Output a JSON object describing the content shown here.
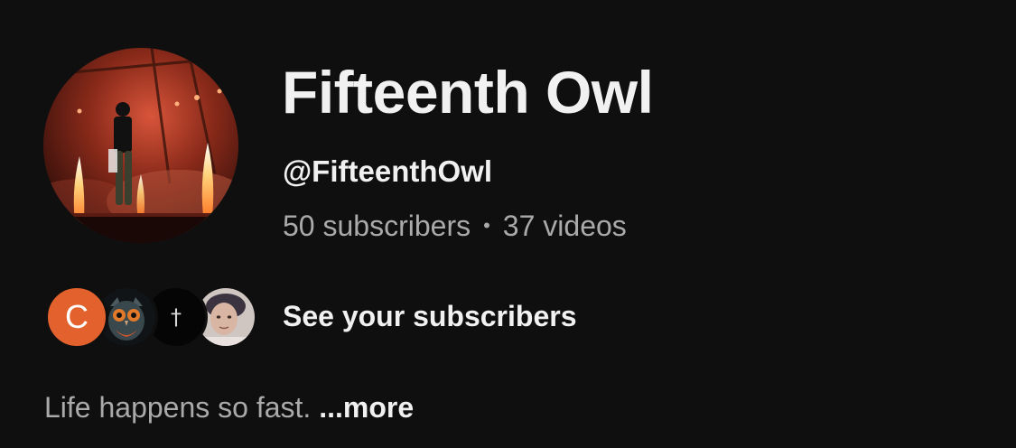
{
  "channel": {
    "name": "Fifteenth Owl",
    "handle": "@FifteenthOwl",
    "subscribers": "50 subscribers",
    "separator": "•",
    "videos": "37 videos",
    "avatar_icon": "concert-stage-photo"
  },
  "subscribers_row": {
    "avatars": [
      {
        "type": "letter",
        "letter": "C",
        "color": "#e2612c"
      },
      {
        "type": "image",
        "icon": "owl-artwork-icon"
      },
      {
        "type": "glyph",
        "glyph": "†"
      },
      {
        "type": "image",
        "icon": "person-photo-icon"
      }
    ],
    "link_label": "See your subscribers"
  },
  "description": {
    "text": "Life happens so fast. ",
    "more_label": "...more"
  },
  "colors": {
    "background": "#0f0f0f",
    "primary_text": "#f1f1f1",
    "secondary_text": "#aaaaaa"
  }
}
